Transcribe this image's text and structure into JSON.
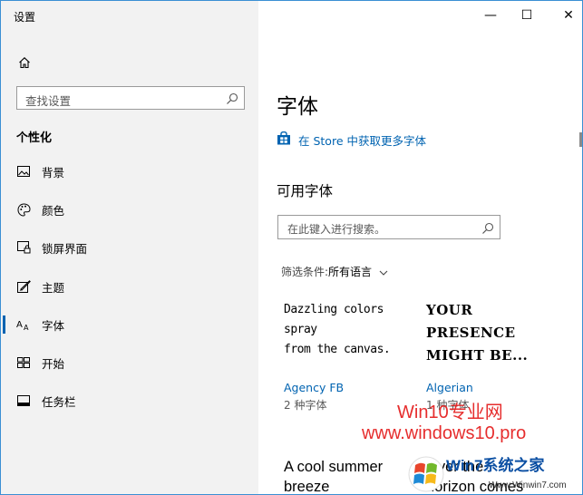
{
  "window": {
    "title": "设置",
    "controls": {
      "minimize": "—",
      "maximize": "☐",
      "close": "✕"
    }
  },
  "sidebar": {
    "home_icon": "home-icon",
    "search": {
      "placeholder": "查找设置",
      "icon": "search-icon"
    },
    "section_label": "个性化",
    "items": [
      {
        "label": "背景",
        "icon": "background-picture-icon",
        "selected": false
      },
      {
        "label": "颜色",
        "icon": "palette-icon",
        "selected": false
      },
      {
        "label": "锁屏界面",
        "icon": "lock-screen-icon",
        "selected": false
      },
      {
        "label": "主题",
        "icon": "theme-brush-icon",
        "selected": false
      },
      {
        "label": "字体",
        "icon": "font-icon",
        "selected": true
      },
      {
        "label": "开始",
        "icon": "start-grid-icon",
        "selected": false
      },
      {
        "label": "任务栏",
        "icon": "taskbar-icon",
        "selected": false
      }
    ]
  },
  "main": {
    "title": "字体",
    "store_link": "在 Store 中获取更多字体",
    "available_heading": "可用字体",
    "search_placeholder": "在此键入进行搜索。",
    "filter_label": "筛选条件:",
    "filter_value": "所有语言",
    "fonts": [
      {
        "sample": "Dazzling colors spray\nfrom the canvas.",
        "name": "Agency FB",
        "count": "2 种字体"
      },
      {
        "sample": "YOUR\nPRESENCE\nMIGHT BE...",
        "name": "Algerian",
        "count": "1 种字体"
      },
      {
        "sample": "A cool summer\nbreeze",
        "name": "",
        "count": ""
      },
      {
        "sample": "Over the\nhorizon comes",
        "name": "",
        "count": ""
      }
    ]
  },
  "watermark": {
    "line1": "Win10专业网",
    "line2": "www.windows10.pro",
    "logo_text": "Win7系统之家",
    "logo_url": "Www.Winwin7.com"
  },
  "colors": {
    "accent": "#0063b1",
    "sidebar_bg": "#f2f2f2",
    "watermark_red": "#e41c1c",
    "window_border": "#3b8fd4"
  }
}
